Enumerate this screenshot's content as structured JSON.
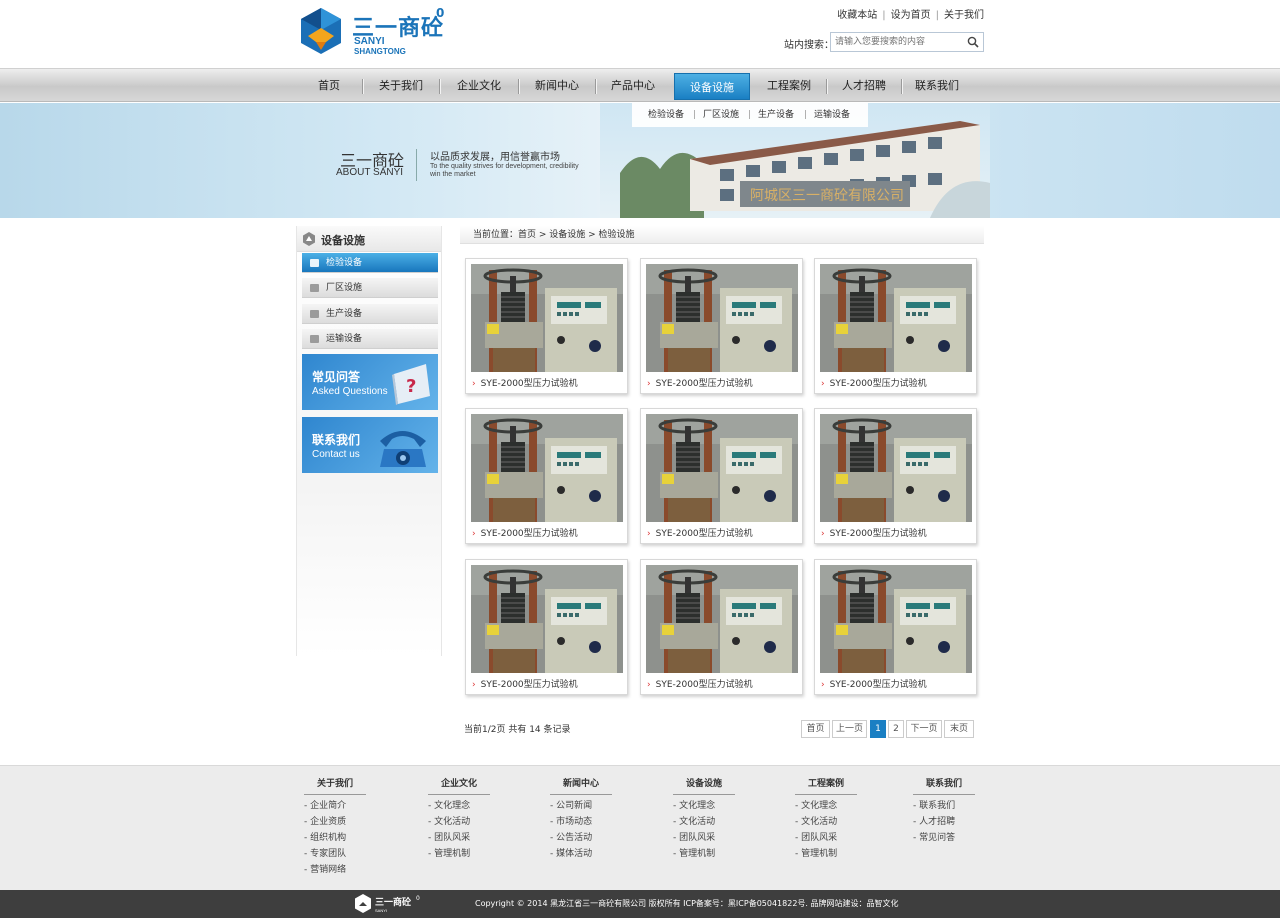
{
  "header": {
    "logo_cn": "三一商砼",
    "logo_en1": "SANYI",
    "logo_en2": "SHANGTONG",
    "logo_sup": "0",
    "top_links": [
      "收藏本站",
      "设为首页",
      "关于我们"
    ],
    "search_label": "站内搜索：",
    "search_placeholder": "请输入您要搜索的内容"
  },
  "nav": {
    "items": [
      "首页",
      "关于我们",
      "企业文化",
      "新闻中心",
      "产品中心",
      "设备设施",
      "工程案例",
      "人才招聘",
      "联系我们"
    ],
    "active": "设备设施"
  },
  "subnav": [
    "检验设备",
    "厂区设施",
    "生产设备",
    "运输设备"
  ],
  "banner": {
    "title_cn": "三一商砼",
    "title_en": "ABOUT SANYI",
    "slogan_cn": "以品质求发展，用信誉赢市场",
    "slogan_en": "To the quality strives for development, credibility win the market",
    "sign": "阿城区三一商砼有限公司"
  },
  "sidebar": {
    "title": "设备设施",
    "items": [
      "检验设备",
      "厂区设施",
      "生产设备",
      "运输设备"
    ],
    "active": "检验设备",
    "promo1_cn": "常见问答",
    "promo1_en": "Asked Questions",
    "promo2_cn": "联系我们",
    "promo2_en": "Contact us"
  },
  "breadcrumb": "当前位置：首页 > 设备设施 > 检验设施",
  "products": [
    {
      "name": "SYE-2000型压力试验机"
    },
    {
      "name": "SYE-2000型压力试验机"
    },
    {
      "name": "SYE-2000型压力试验机"
    },
    {
      "name": "SYE-2000型压力试验机"
    },
    {
      "name": "SYE-2000型压力试验机"
    },
    {
      "name": "SYE-2000型压力试验机"
    },
    {
      "name": "SYE-2000型压力试验机"
    },
    {
      "name": "SYE-2000型压力试验机"
    },
    {
      "name": "SYE-2000型压力试验机"
    }
  ],
  "product_bullet": "›",
  "pagination": {
    "info": "当前1/2页 共有 14 条记录",
    "first": "首页",
    "prev": "上一页",
    "pages": [
      "1",
      "2"
    ],
    "current": "1",
    "next": "下一页",
    "last": "末页"
  },
  "footer": {
    "columns": [
      {
        "title": "关于我们",
        "links": [
          "企业简介",
          "企业资质",
          "组织机构",
          "专家团队",
          "营销网络"
        ]
      },
      {
        "title": "企业文化",
        "links": [
          "文化理念",
          "文化活动",
          "团队风采",
          "管理机制"
        ]
      },
      {
        "title": "新闻中心",
        "links": [
          "公司新闻",
          "市场动态",
          "公告活动",
          "媒体活动"
        ]
      },
      {
        "title": "设备设施",
        "links": [
          "文化理念",
          "文化活动",
          "团队风采",
          "管理机制"
        ]
      },
      {
        "title": "工程案例",
        "links": [
          "文化理念",
          "文化活动",
          "团队风采",
          "管理机制"
        ]
      },
      {
        "title": "联系我们",
        "links": [
          "联系我们",
          "人才招聘",
          "常见问答"
        ]
      }
    ],
    "link_prefix": "-",
    "copyright": "Copyright © 2014 黑龙江省三一商砼有限公司 版权所有    ICP备案号：黑ICP备05041822号.  品牌网站建设：品智文化"
  },
  "colors": {
    "brand": "#1b74b9",
    "active": "#1a7fc3",
    "footer_bg": "#ececec",
    "bottom_bg": "#3e3e3e"
  }
}
